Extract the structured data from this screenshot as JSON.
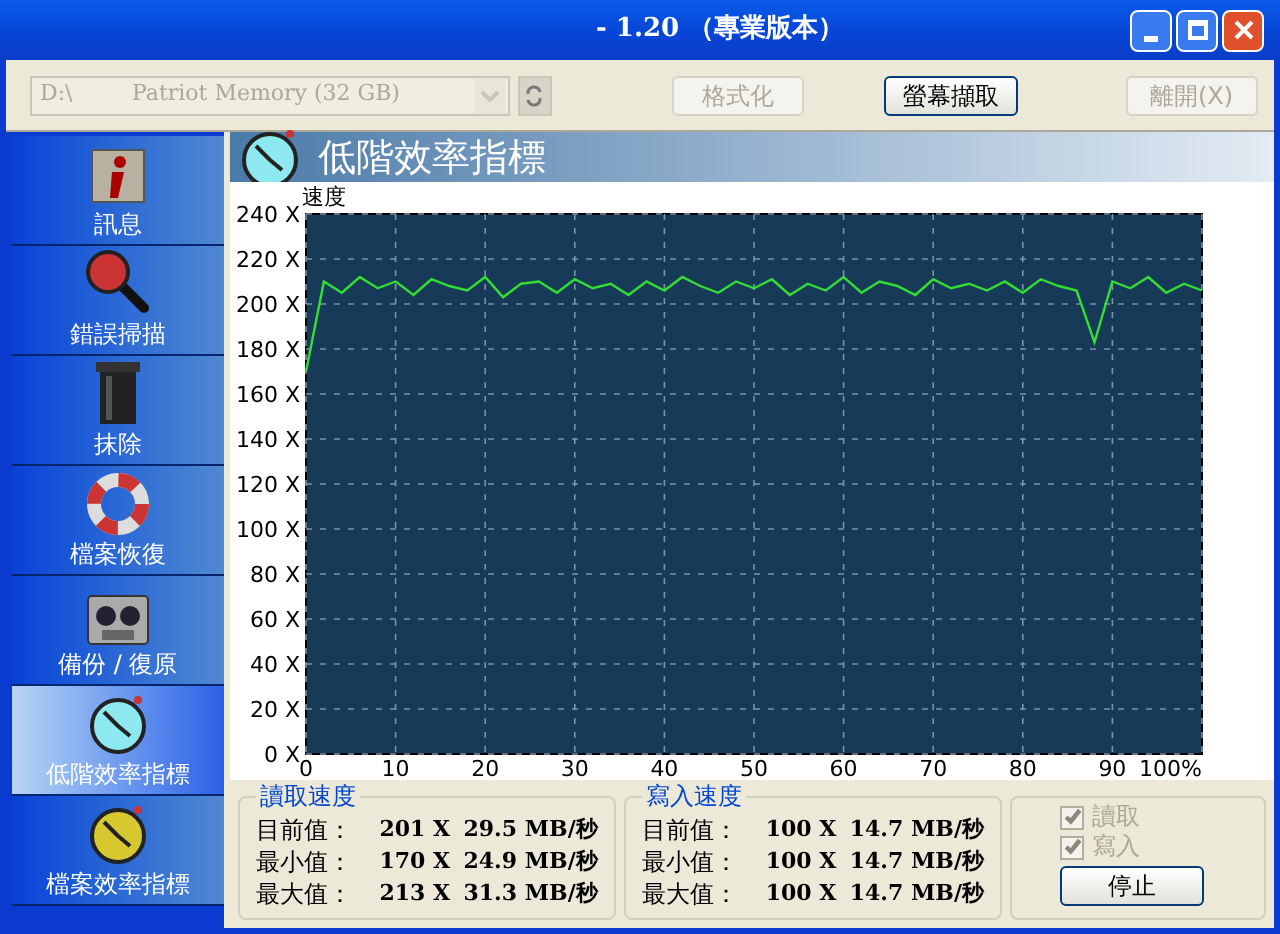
{
  "window": {
    "title": "- 1.20 （專業版本）"
  },
  "toolbar": {
    "drive_select": {
      "drive": "D:\\",
      "device": "Patriot Memory (32 GB)",
      "disabled": true
    },
    "buttons": [
      {
        "label": "格式化",
        "disabled": true
      },
      {
        "label": "螢幕擷取",
        "disabled": false
      },
      {
        "label": "離開(X)",
        "disabled": true
      }
    ]
  },
  "sidebar": {
    "items": [
      {
        "label": "訊息",
        "kind": "info",
        "selected": false
      },
      {
        "label": "錯誤掃描",
        "kind": "scan",
        "selected": false
      },
      {
        "label": "抹除",
        "kind": "erase",
        "selected": false
      },
      {
        "label": "檔案恢復",
        "kind": "recover",
        "selected": false
      },
      {
        "label": "備份 / 復原",
        "kind": "backup",
        "selected": false
      },
      {
        "label": "低階效率指標",
        "kind": "lowbench",
        "selected": true
      },
      {
        "label": "檔案效率指標",
        "kind": "filebench",
        "selected": false
      }
    ]
  },
  "panel": {
    "title": "低階效率指標",
    "chart_data": {
      "type": "line",
      "ylabel": "速度",
      "x": [
        0,
        2,
        4,
        6,
        8,
        10,
        12,
        14,
        16,
        18,
        20,
        22,
        24,
        26,
        28,
        30,
        32,
        34,
        36,
        38,
        40,
        42,
        44,
        46,
        48,
        50,
        52,
        54,
        56,
        58,
        60,
        62,
        64,
        66,
        68,
        70,
        72,
        74,
        76,
        78,
        80,
        82,
        84,
        86,
        88,
        90,
        92,
        94,
        96,
        98,
        100
      ],
      "grid": true,
      "series": [
        {
          "color": "#33dd33",
          "values": [
            170,
            210,
            205,
            212,
            207,
            210,
            204,
            211,
            208,
            206,
            212,
            203,
            209,
            210,
            205,
            211,
            207,
            209,
            204,
            210,
            206,
            212,
            208,
            205,
            210,
            207,
            211,
            204,
            209,
            206,
            212,
            205,
            210,
            208,
            204,
            211,
            207,
            209,
            206,
            210,
            205,
            211,
            208,
            206,
            183,
            210,
            207,
            212,
            205,
            209,
            206
          ]
        }
      ],
      "xlim": [
        0,
        100
      ],
      "ylim": [
        0,
        240
      ],
      "xticks": [
        0,
        10,
        20,
        30,
        40,
        50,
        60,
        70,
        80,
        90,
        {
          "value": 100,
          "label": "100%"
        }
      ],
      "yticks": [
        {
          "value": 0,
          "label": "0 X"
        },
        {
          "value": 20,
          "label": "20 X"
        },
        {
          "value": 40,
          "label": "40 X"
        },
        {
          "value": 60,
          "label": "60 X"
        },
        {
          "value": 80,
          "label": "80 X"
        },
        {
          "value": 100,
          "label": "100 X"
        },
        {
          "value": 120,
          "label": "120 X"
        },
        {
          "value": 140,
          "label": "140 X"
        },
        {
          "value": 160,
          "label": "160 X"
        },
        {
          "value": 180,
          "label": "180 X"
        },
        {
          "value": 200,
          "label": "200 X"
        },
        {
          "value": 220,
          "label": "220 X"
        },
        {
          "value": 240,
          "label": "240 X"
        }
      ]
    }
  },
  "read_speed": {
    "title": "讀取速度",
    "rows": [
      {
        "label": "目前值：",
        "multiplier": "201 X",
        "rate": "29.5 MB/秒"
      },
      {
        "label": "最小值：",
        "multiplier": "170 X",
        "rate": "24.9 MB/秒"
      },
      {
        "label": "最大值：",
        "multiplier": "213 X",
        "rate": "31.3 MB/秒"
      }
    ]
  },
  "write_speed": {
    "title": "寫入速度",
    "rows": [
      {
        "label": "目前值：",
        "multiplier": "100 X",
        "rate": "14.7 MB/秒"
      },
      {
        "label": "最小值：",
        "multiplier": "100 X",
        "rate": "14.7 MB/秒"
      },
      {
        "label": "最大值：",
        "multiplier": "100 X",
        "rate": "14.7 MB/秒"
      }
    ]
  },
  "options": {
    "checkboxes": [
      {
        "label": "讀取",
        "checked": true,
        "disabled": true
      },
      {
        "label": "寫入",
        "checked": true,
        "disabled": true
      }
    ],
    "button": "停止"
  }
}
